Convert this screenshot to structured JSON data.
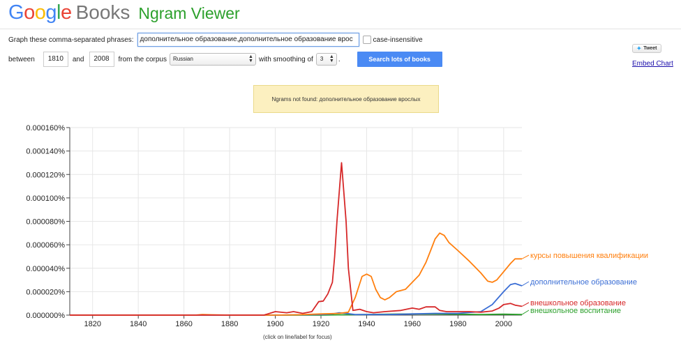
{
  "header": {
    "logo_letters": [
      {
        "ch": "G",
        "color": "#4285f4"
      },
      {
        "ch": "o",
        "color": "#ea4335"
      },
      {
        "ch": "o",
        "color": "#fbbc05"
      },
      {
        "ch": "g",
        "color": "#4285f4"
      },
      {
        "ch": "l",
        "color": "#34a853"
      },
      {
        "ch": "e",
        "color": "#ea4335"
      }
    ],
    "logo_books": "Books",
    "app_title": "Ngram Viewer"
  },
  "form": {
    "phrases_label": "Graph these comma-separated phrases:",
    "phrases_value": "дополнительное образование,дополнительное образование врос",
    "case_insensitive_label": "case-insensitive",
    "between_label": "between",
    "start_year": "1810",
    "and_label": "and",
    "end_year": "2008",
    "corpus_label": "from the corpus",
    "corpus_value": "Russian",
    "smoothing_label": "with smoothing of",
    "smoothing_value": "3",
    "period": ".",
    "search_button": "Search lots of books"
  },
  "social": {
    "tweet_label": "Tweet",
    "embed_label": "Embed Chart"
  },
  "notice": {
    "text": "Ngrams not found: дополнительное образование врослых"
  },
  "chart_caption": "(click on line/label for focus)",
  "chart_data": {
    "type": "line",
    "xlim": [
      1810,
      2008
    ],
    "ylim": [
      0,
      1.6e-06
    ],
    "grid": true,
    "x_ticks": [
      1820,
      1840,
      1860,
      1880,
      1900,
      1920,
      1940,
      1960,
      1980,
      2000
    ],
    "y_ticks": [
      {
        "value": 0,
        "label": "0.000000%"
      },
      {
        "value": 2e-07,
        "label": "0.000020%"
      },
      {
        "value": 4e-07,
        "label": "0.000040%"
      },
      {
        "value": 6e-07,
        "label": "0.000060%"
      },
      {
        "value": 8e-07,
        "label": "0.000080%"
      },
      {
        "value": 1e-06,
        "label": "0.000100%"
      },
      {
        "value": 1.2e-06,
        "label": "0.000120%"
      },
      {
        "value": 1.4e-06,
        "label": "0.000140%"
      },
      {
        "value": 1.6e-06,
        "label": "0.000160%"
      }
    ],
    "series": [
      {
        "name": "курсы повышения квалификации",
        "color": "#ff7f0e",
        "points": [
          [
            1810,
            0
          ],
          [
            1865,
            0
          ],
          [
            1868,
            5e-09
          ],
          [
            1872,
            3e-09
          ],
          [
            1880,
            0
          ],
          [
            1900,
            0
          ],
          [
            1910,
            3e-09
          ],
          [
            1920,
            1e-08
          ],
          [
            1928,
            1.5e-08
          ],
          [
            1932,
            2.5e-08
          ],
          [
            1935,
            1.5e-07
          ],
          [
            1938,
            3.3e-07
          ],
          [
            1940,
            3.5e-07
          ],
          [
            1942,
            3.3e-07
          ],
          [
            1944,
            2.2e-07
          ],
          [
            1946,
            1.5e-07
          ],
          [
            1948,
            1.3e-07
          ],
          [
            1950,
            1.5e-07
          ],
          [
            1953,
            2e-07
          ],
          [
            1957,
            2.2e-07
          ],
          [
            1960,
            2.8e-07
          ],
          [
            1963,
            3.4e-07
          ],
          [
            1966,
            4.5e-07
          ],
          [
            1968,
            5.5e-07
          ],
          [
            1970,
            6.5e-07
          ],
          [
            1972,
            7e-07
          ],
          [
            1974,
            6.8e-07
          ],
          [
            1976,
            6.2e-07
          ],
          [
            1980,
            5.5e-07
          ],
          [
            1985,
            4.6e-07
          ],
          [
            1990,
            3.6e-07
          ],
          [
            1993,
            2.9e-07
          ],
          [
            1995,
            2.8e-07
          ],
          [
            1997,
            3e-07
          ],
          [
            2000,
            3.7e-07
          ],
          [
            2003,
            4.4e-07
          ],
          [
            2005,
            4.8e-07
          ],
          [
            2008,
            4.8e-07
          ]
        ]
      },
      {
        "name": "дополнительное образование",
        "color": "#3b6ed5",
        "points": [
          [
            1810,
            0
          ],
          [
            1900,
            0
          ],
          [
            1920,
            5e-09
          ],
          [
            1925,
            1e-08
          ],
          [
            1928,
            2e-08
          ],
          [
            1931,
            1.5e-08
          ],
          [
            1935,
            5e-09
          ],
          [
            1940,
            5e-09
          ],
          [
            1950,
            5e-09
          ],
          [
            1960,
            1e-08
          ],
          [
            1970,
            1.5e-08
          ],
          [
            1980,
            1.5e-08
          ],
          [
            1990,
            3e-08
          ],
          [
            1995,
            9e-08
          ],
          [
            2000,
            2e-07
          ],
          [
            2003,
            2.6e-07
          ],
          [
            2005,
            2.7e-07
          ],
          [
            2008,
            2.5e-07
          ]
        ]
      },
      {
        "name": "внешкольное образование",
        "color": "#d62728",
        "points": [
          [
            1810,
            0
          ],
          [
            1895,
            0
          ],
          [
            1900,
            3e-08
          ],
          [
            1905,
            2e-08
          ],
          [
            1908,
            3e-08
          ],
          [
            1912,
            1.5e-08
          ],
          [
            1916,
            3e-08
          ],
          [
            1919,
            1.15e-07
          ],
          [
            1921,
            1.2e-07
          ],
          [
            1923,
            1.8e-07
          ],
          [
            1925,
            2.8e-07
          ],
          [
            1926,
            5e-07
          ],
          [
            1927,
            8e-07
          ],
          [
            1929,
            1.3e-06
          ],
          [
            1931,
            8e-07
          ],
          [
            1932,
            4e-07
          ],
          [
            1934,
            4e-08
          ],
          [
            1937,
            5e-08
          ],
          [
            1940,
            3e-08
          ],
          [
            1943,
            2e-08
          ],
          [
            1948,
            3e-08
          ],
          [
            1955,
            4e-08
          ],
          [
            1960,
            6e-08
          ],
          [
            1963,
            5e-08
          ],
          [
            1966,
            7e-08
          ],
          [
            1970,
            7e-08
          ],
          [
            1972,
            4e-08
          ],
          [
            1975,
            3e-08
          ],
          [
            1980,
            3e-08
          ],
          [
            1985,
            3e-08
          ],
          [
            1990,
            2.5e-08
          ],
          [
            1995,
            3.5e-08
          ],
          [
            1998,
            6e-08
          ],
          [
            2000,
            9e-08
          ],
          [
            2003,
            1e-07
          ],
          [
            2005,
            8.5e-08
          ],
          [
            2008,
            7.5e-08
          ]
        ]
      },
      {
        "name": "внешкольное воспитание",
        "color": "#2ca02c",
        "points": [
          [
            1810,
            0
          ],
          [
            1920,
            0
          ],
          [
            1930,
            3e-09
          ],
          [
            1940,
            5e-09
          ],
          [
            1950,
            8e-09
          ],
          [
            1960,
            1e-08
          ],
          [
            1970,
            1e-08
          ],
          [
            1980,
            8e-09
          ],
          [
            1990,
            5e-09
          ],
          [
            2000,
            8e-09
          ],
          [
            2008,
            5e-09
          ]
        ]
      }
    ]
  }
}
